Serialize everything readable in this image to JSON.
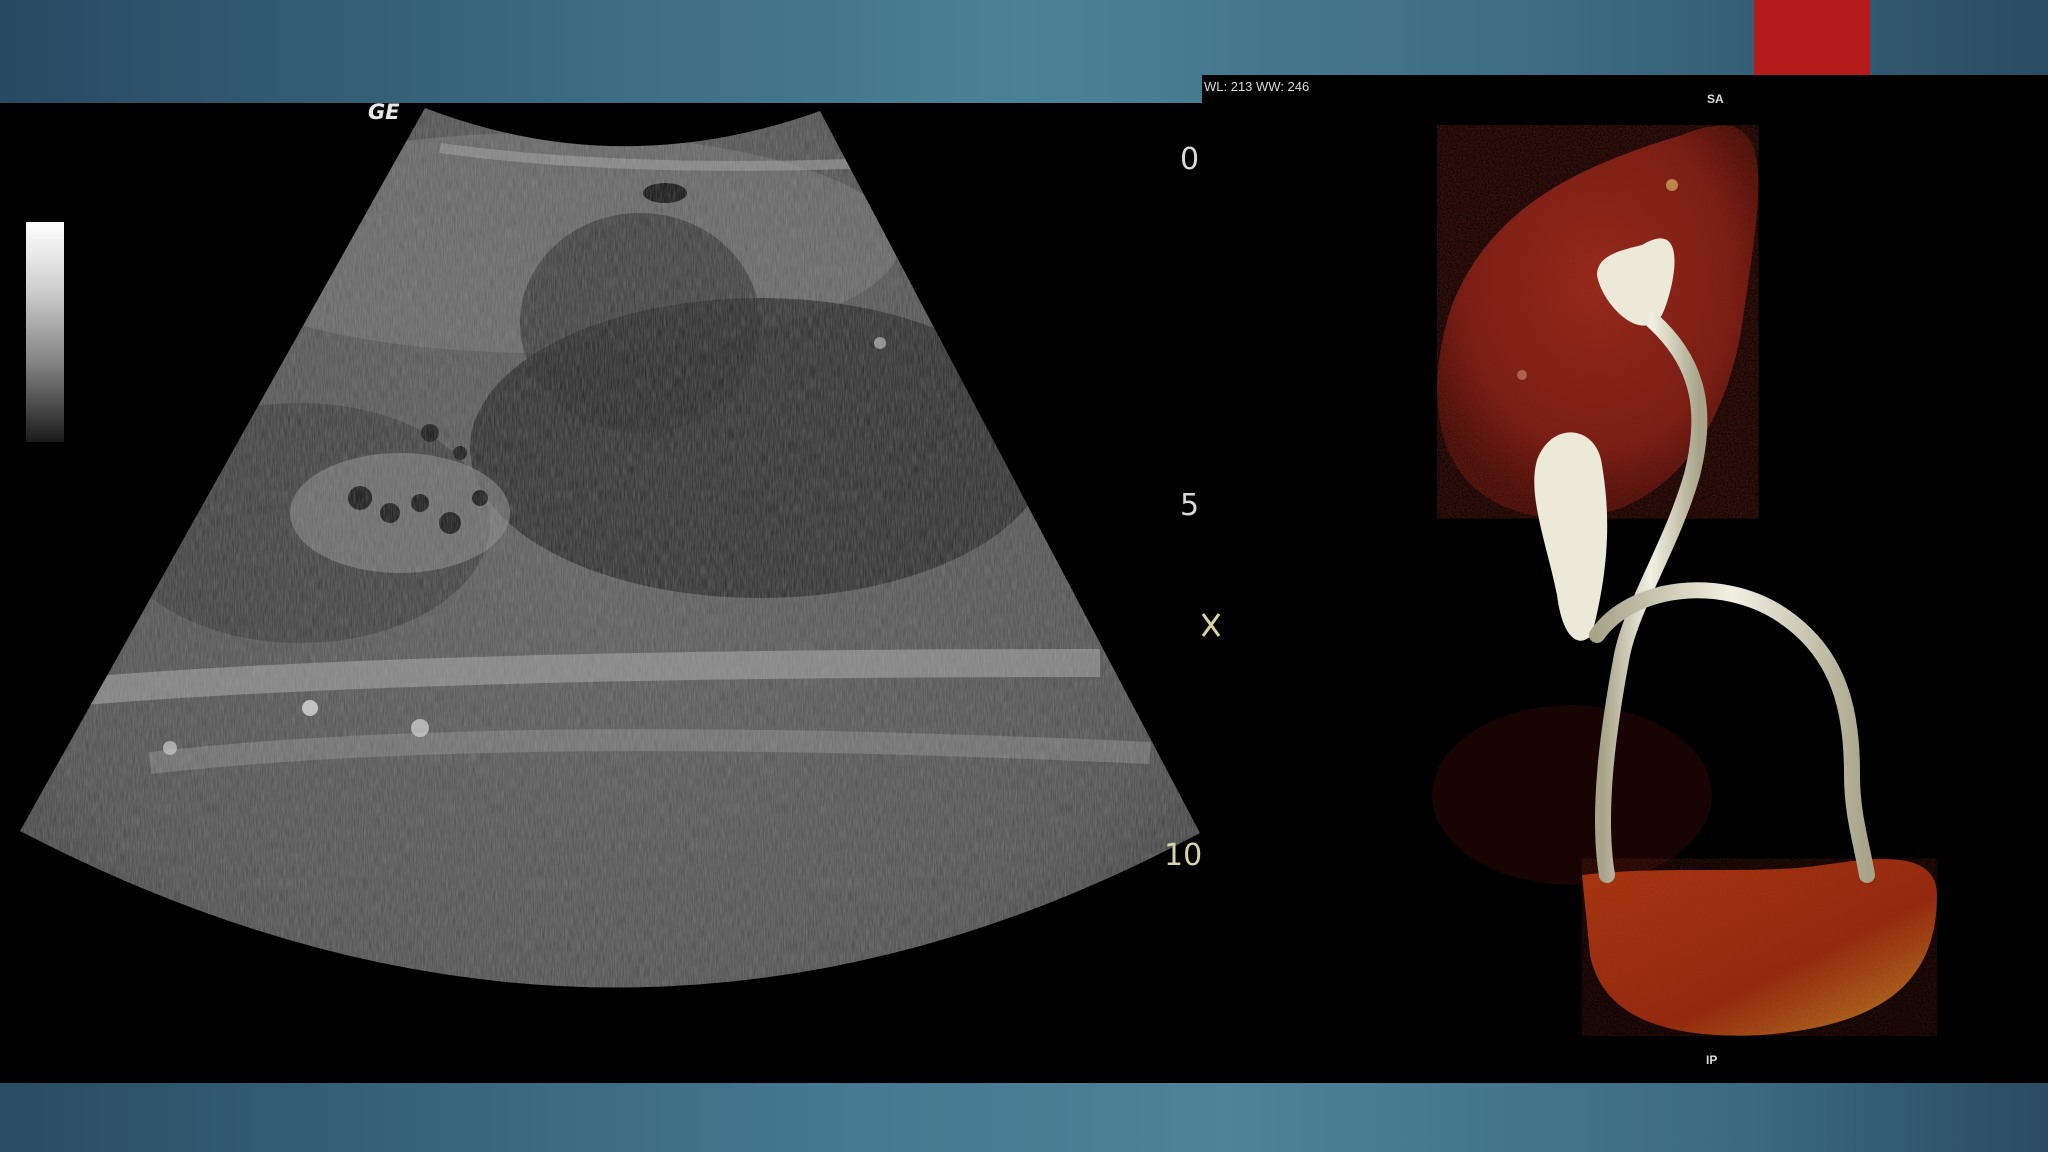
{
  "ultrasound": {
    "vendor_logo": "GE",
    "depth_labels": {
      "d0": "0",
      "d5": "5",
      "d10": "10"
    }
  },
  "ct_3d": {
    "window_info": "WL: 213 WW: 246",
    "orientation_top": "SA",
    "orientation_bottom": "IP"
  },
  "colors": {
    "accent_red": "#b51a1a",
    "background_blue": "#3f6f86",
    "kidney_red": "#8a1e14",
    "bladder_orange": "#b04a12",
    "contrast_white": "#e8e6d6"
  }
}
